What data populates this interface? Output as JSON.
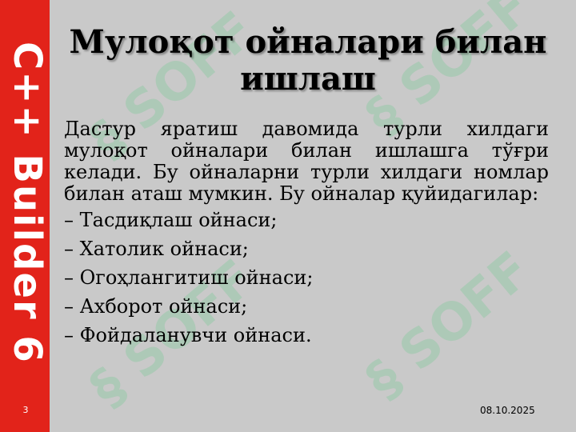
{
  "slide": {
    "sidebar_text": "C++ Builder 6",
    "number": "3",
    "watermark_text": "§ SOFF",
    "title": "Мулоқот ойналари билан ишлаш",
    "paragraph": "Дастур яратиш давомида турли хилдаги мулоқот ойналари билан ишлашга тўғри келади. Бу ойналарни турли хилдаги номлар билан аташ мумкин. Бу ойналар қуйидагилар:",
    "list_items": [
      "– Тасдиқлаш ойнаси;",
      "– Хатолик ойнаси;",
      "– Огоҳлангитиш ойнаси;",
      "– Ахборот ойнаси;",
      "– Фойдаланувчи ойнаси."
    ],
    "date": "08.10.2025"
  },
  "colors": {
    "background": "#c9c9c9",
    "sidebar": "#e2231a",
    "watermark": "#78c896"
  }
}
